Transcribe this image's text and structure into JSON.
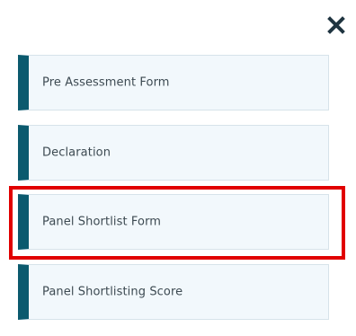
{
  "close_icon": "close-icon",
  "accent_color": "#0b5a6e",
  "highlight_color": "#e10000",
  "menu": {
    "items": [
      {
        "label": "Pre Assessment Form"
      },
      {
        "label": "Declaration"
      },
      {
        "label": "Panel Shortlist Form"
      },
      {
        "label": "Panel Shortlisting Score"
      }
    ]
  }
}
